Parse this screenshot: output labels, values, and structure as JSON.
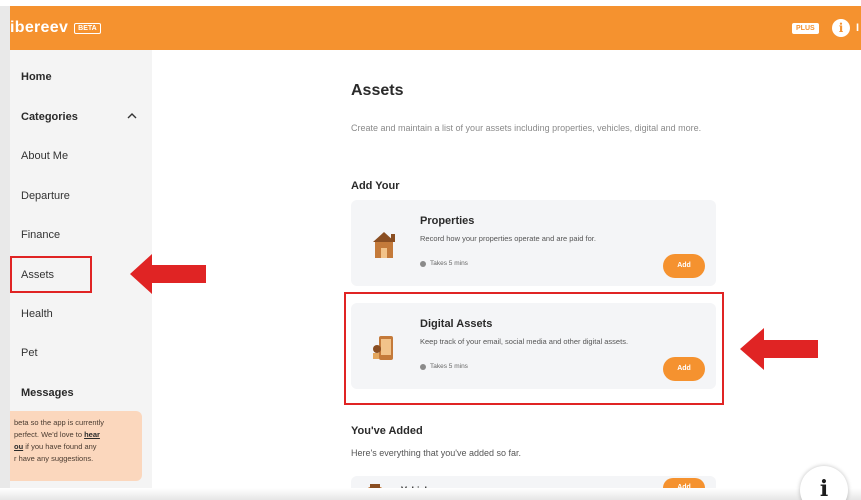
{
  "topbar": {
    "logo_text": "ibereev",
    "beta_label": "BETA",
    "plus_label": "PLUS",
    "info_glyph": "i",
    "user_initial": "I",
    "brand_color": "#f5922f"
  },
  "sidebar": {
    "items": [
      {
        "label": "Home",
        "bold": true
      },
      {
        "label": "Categories",
        "bold": true
      },
      {
        "label": "About Me",
        "bold": false
      },
      {
        "label": "Departure",
        "bold": false
      },
      {
        "label": "Finance",
        "bold": false
      },
      {
        "label": "Assets",
        "bold": false
      },
      {
        "label": "Health",
        "bold": false
      },
      {
        "label": "Pet",
        "bold": false
      },
      {
        "label": "Messages",
        "bold": true
      }
    ],
    "beta_note": {
      "line1": "beta so the app is currently",
      "line2_prefix": "perfect. We'd love to ",
      "line2_link": "hear",
      "line3_link": "ou",
      "line3_suffix": " if you have found any",
      "line4": "r have any suggestions."
    }
  },
  "main": {
    "title": "Assets",
    "description": "Create and maintain a list of your assets including properties, vehicles, digital and more.",
    "add_section_title": "Add Your",
    "cards": [
      {
        "title": "Properties",
        "description": "Record how your properties operate and are paid for.",
        "time": "Takes 5 mins",
        "button": "Add",
        "icon": "house-icon"
      },
      {
        "title": "Digital Assets",
        "description": "Keep track of your email, social media and other digital assets.",
        "time": "Takes 5 mins",
        "button": "Add",
        "icon": "phone-icon"
      }
    ],
    "added_section_title": "You've Added",
    "added_section_desc": "Here's everything that you've added so far.",
    "added_items": [
      {
        "title": "Vehicles",
        "button": "Add",
        "icon": "car-icon"
      }
    ]
  },
  "help_fab": {
    "glyph": "i"
  },
  "annotation_color": "#e02424"
}
